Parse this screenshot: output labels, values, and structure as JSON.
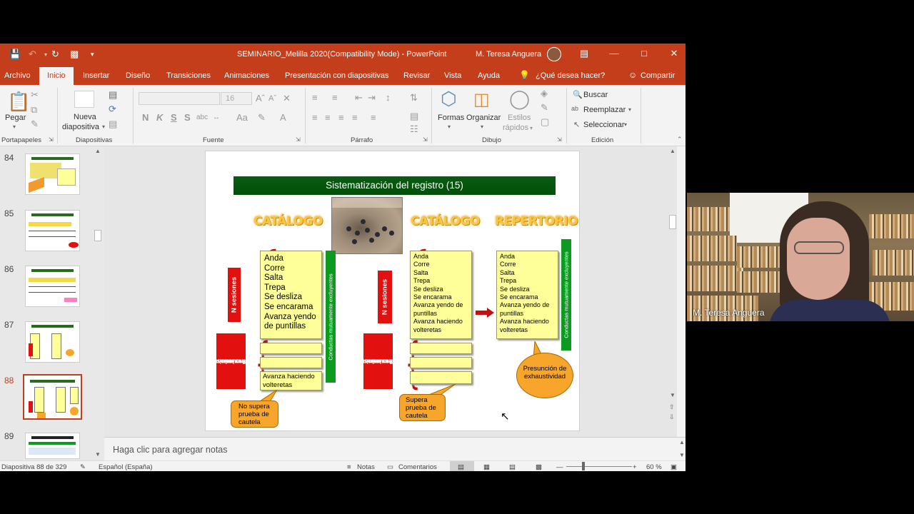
{
  "window": {
    "title": "SEMINARIO_Melilla 2020(Compatibility Mode)  -  PowerPoint",
    "user": "M. Teresa Anguera"
  },
  "menu": {
    "tabs": [
      "Archivo",
      "Inicio",
      "Insertar",
      "Diseño",
      "Transiciones",
      "Animaciones",
      "Presentación con diapositivas",
      "Revisar",
      "Vista",
      "Ayuda"
    ],
    "tell_me": "¿Qué desea hacer?",
    "share": "Compartir"
  },
  "ribbon": {
    "paste": "Pegar",
    "new_slide_1": "Nueva",
    "new_slide_2": "diapositiva",
    "font_size": "16",
    "font_style_labels": [
      "N",
      "K",
      "S",
      "S"
    ],
    "shapes": "Formas",
    "arrange": "Organizar",
    "quick_styles_1": "Estilos",
    "quick_styles_2": "rápidos",
    "find": "Buscar",
    "replace": "Reemplazar",
    "select": "Seleccionar",
    "groups": [
      "Portapapeles",
      "Diapositivas",
      "Fuente",
      "Párrafo",
      "Dibujo",
      "Edición"
    ]
  },
  "thumbnails": {
    "numbers": [
      "84",
      "85",
      "86",
      "87",
      "88",
      "89"
    ],
    "selected": "88"
  },
  "slide": {
    "title": "Sistematización del registro (15)",
    "col1_header": "CATÁLOGO",
    "col2_header": "CATÁLOGO",
    "col3_header": "REPERTORIO",
    "n_sessions": "N sesiones",
    "new_sessions_1": "3 nuevas",
    "new_sessions_2": "sesiones",
    "new_sessions_3": "como mínimo",
    "exclusive": "Conductas mutuamente excluyentes",
    "col1_items": [
      "Anda",
      "Corre",
      "Salta",
      "Trepa",
      "Se desliza",
      "Se encarama",
      "Avanza yendo",
      "de puntillas"
    ],
    "col1_extra_1": "Avanza haciendo",
    "col1_extra_2": "volteretas",
    "col2_items": [
      "Anda",
      "Corre",
      "Salta",
      "Trepa",
      "Se desliza",
      "Se encarama",
      "Avanza yendo de",
      "puntillas",
      "Avanza haciendo",
      "volteretas"
    ],
    "col3_items": [
      "Anda",
      "Corre",
      "Salta",
      "Trepa",
      "Se desliza",
      "Se encarama",
      "Avanza yendo de",
      "puntillas",
      "Avanza haciendo",
      "volteretas"
    ],
    "callout1_1": "No supera",
    "callout1_2": "prueba de",
    "callout1_3": "cautela",
    "callout2_1": "Supera",
    "callout2_2": "prueba de",
    "callout2_3": "cautela",
    "callout3_1": "Presunción de",
    "callout3_2": "exhaustividad"
  },
  "notes_placeholder": "Haga clic para agregar notas",
  "status": {
    "slide_counter": "Diapositiva 88 de 329",
    "language": "Español (España)",
    "notes": "Notas",
    "comments": "Comentarios",
    "zoom": "60 %"
  },
  "webcam": {
    "name": "M. Teresa Anguera"
  }
}
